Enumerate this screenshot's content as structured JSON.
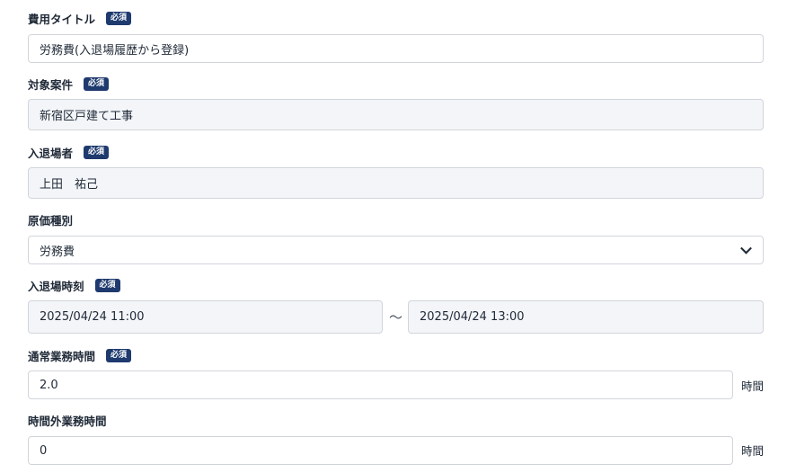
{
  "form": {
    "title": {
      "label": "費用タイトル",
      "badge": "必須",
      "value": "労務費(入退場履歴から登録)"
    },
    "project": {
      "label": "対象案件",
      "badge": "必須",
      "value": "新宿区戸建て工事"
    },
    "person": {
      "label": "入退場者",
      "badge": "必須",
      "value": "上田　祐己"
    },
    "cost_type": {
      "label": "原価種別",
      "value": "労務費"
    },
    "entry_time": {
      "label": "入退場時刻",
      "badge": "必須",
      "start": "2025/04/24 11:00",
      "separator": "〜",
      "end": "2025/04/24 13:00"
    },
    "regular_hours": {
      "label": "通常業務時間",
      "badge": "必須",
      "value": "2.0",
      "unit": "時間"
    },
    "overtime_hours": {
      "label": "時間外業務時間",
      "value": "0",
      "unit": "時間"
    }
  },
  "colors": {
    "badge_bg": "#1e3a6e",
    "readonly_bg": "#f3f5f8",
    "border": "#d1d5db"
  }
}
